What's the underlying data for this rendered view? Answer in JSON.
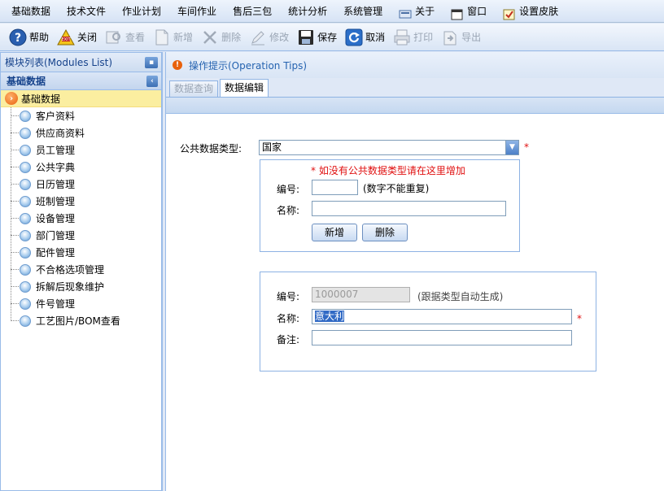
{
  "menubar": {
    "items": [
      "基础数据",
      "技术文件",
      "作业计划",
      "车间作业",
      "售后三包",
      "统计分析",
      "系统管理"
    ],
    "about": "关于",
    "window": "窗口",
    "skin": "设置皮肤"
  },
  "toolbar": {
    "help": "帮助",
    "close": "关闭",
    "view": "查看",
    "new": "新增",
    "delete": "删除",
    "edit": "修改",
    "save": "保存",
    "cancel": "取消",
    "print": "打印",
    "export": "导出"
  },
  "left_panel": {
    "title": "模块列表(Modules List)",
    "section": "基础数据",
    "root": "基础数据",
    "items": [
      "客户资料",
      "供应商资料",
      "员工管理",
      "公共字典",
      "日历管理",
      "班制管理",
      "设备管理",
      "部门管理",
      "配件管理",
      "不合格选项管理",
      "拆解后现象维护",
      "件号管理",
      "工艺图片/BOM查看"
    ]
  },
  "right_panel": {
    "tips": "操作提示(Operation Tips)",
    "tabs": [
      "数据查询",
      "数据编辑"
    ],
    "form": {
      "type_label": "公共数据类型:",
      "type_value": "国家",
      "required_mark": "*",
      "hint": "* 如没有公共数据类型请在这里增加",
      "code_label": "编号:",
      "code_value": "",
      "code_note": "(数字不能重复)",
      "name_label": "名称:",
      "name_value": "",
      "add_button": "新增",
      "delete_button": "删除",
      "code2_label": "编号:",
      "code2_value": "1000007",
      "code2_note": "(跟据类型自动生成)",
      "name2_label": "名称:",
      "name2_value": "意大利",
      "remark_label": "备注:",
      "remark_value": ""
    }
  }
}
